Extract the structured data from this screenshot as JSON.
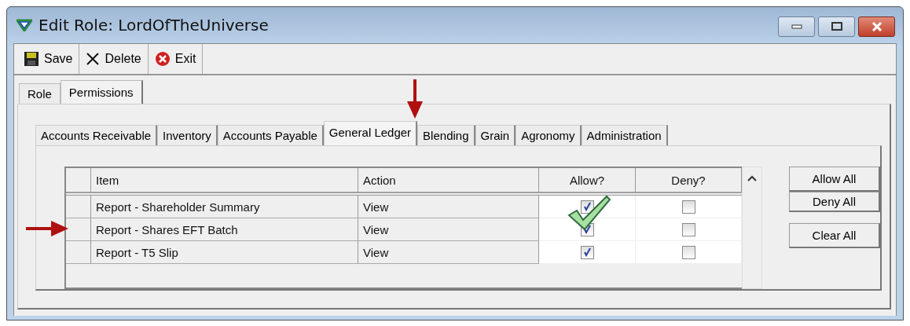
{
  "window": {
    "title": "Edit Role: LordOfTheUniverse"
  },
  "toolbar": [
    {
      "label": "Save",
      "kind": "save"
    },
    {
      "label": "Delete",
      "kind": "delete"
    },
    {
      "label": "Exit",
      "kind": "exit"
    }
  ],
  "tabs": [
    {
      "label": "Role",
      "selected": false
    },
    {
      "label": "Permissions",
      "selected": true
    }
  ],
  "module_tabs": [
    {
      "label": "Accounts Receivable",
      "selected": false
    },
    {
      "label": "Inventory",
      "selected": false
    },
    {
      "label": "Accounts Payable",
      "selected": false
    },
    {
      "label": "General Ledger",
      "selected": true
    },
    {
      "label": "Blending",
      "selected": false
    },
    {
      "label": "Grain",
      "selected": false
    },
    {
      "label": "Agronomy",
      "selected": false
    },
    {
      "label": "Administration",
      "selected": false
    }
  ],
  "table": {
    "columns": [
      "Item",
      "Action",
      "Allow?",
      "Deny?"
    ],
    "rows": [
      {
        "item": "Report - Shareholder Summary",
        "action": "View",
        "allow": true,
        "deny": false
      },
      {
        "item": "Report - Shares EFT Batch",
        "action": "View",
        "allow": true,
        "deny": false
      },
      {
        "item": "Report - T5 Slip",
        "action": "View",
        "allow": true,
        "deny": false
      }
    ]
  },
  "buttons": [
    "Allow All",
    "Deny All",
    "Clear All"
  ]
}
